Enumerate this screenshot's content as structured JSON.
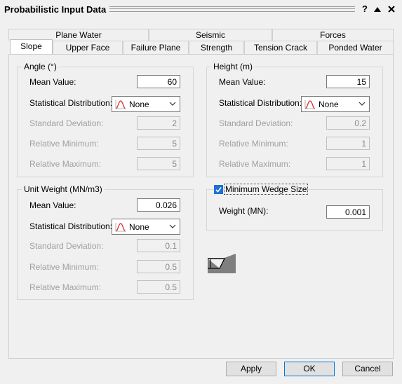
{
  "window": {
    "title": "Probabilistic Input Data"
  },
  "title_buttons": {
    "help": "?",
    "collapse": "▲",
    "close": "✕"
  },
  "tabs_row1": [
    "Plane Water",
    "Seismic",
    "Forces"
  ],
  "tabs_row2": [
    "Slope",
    "Upper Face",
    "Failure Plane",
    "Strength",
    "Tension Crack",
    "Ponded Water"
  ],
  "active_tab": "Slope",
  "angle": {
    "title": "Angle (°)",
    "mean_label": "Mean Value:",
    "mean_value": "60",
    "dist_label": "Statistical Distribution:",
    "dist_value": "None",
    "sd_label": "Standard Deviation:",
    "sd_value": "2",
    "rmin_label": "Relative Minimum:",
    "rmin_value": "5",
    "rmax_label": "Relative Maximum:",
    "rmax_value": "5"
  },
  "height": {
    "title": "Height (m)",
    "mean_label": "Mean Value:",
    "mean_value": "15",
    "dist_label": "Statistical Distribution:",
    "dist_value": "None",
    "sd_label": "Standard Deviation:",
    "sd_value": "0.2",
    "rmin_label": "Relative Minimum:",
    "rmin_value": "1",
    "rmax_label": "Relative Maximum:",
    "rmax_value": "1"
  },
  "unit_weight": {
    "title": "Unit Weight (MN/m3)",
    "mean_label": "Mean Value:",
    "mean_value": "0.026",
    "dist_label": "Statistical Distribution:",
    "dist_value": "None",
    "sd_label": "Standard Deviation:",
    "sd_value": "0.1",
    "rmin_label": "Relative Minimum:",
    "rmin_value": "0.5",
    "rmax_label": "Relative Maximum:",
    "rmax_value": "0.5"
  },
  "min_wedge": {
    "label": "Minimum Wedge Size",
    "checked": true,
    "weight_label": "Weight (MN):",
    "weight_value": "0.001"
  },
  "buttons": {
    "apply": "Apply",
    "ok": "OK",
    "cancel": "Cancel"
  },
  "colors": {
    "accent": "#1f6fd6",
    "background": "#f0f0f0",
    "default_button_border": "#0078d7"
  }
}
